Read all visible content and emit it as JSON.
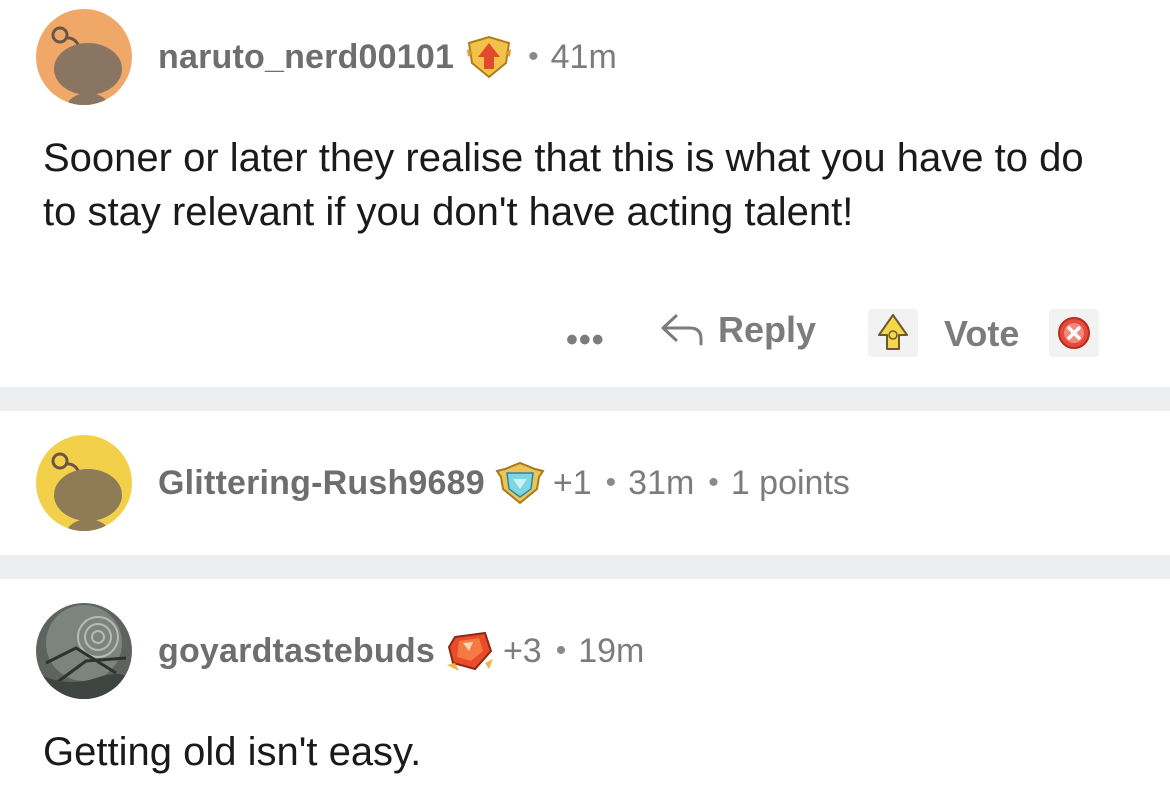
{
  "comments": [
    {
      "username": "naruto_nerd00101",
      "flair_icon": "orange-arrow-shield-badge-icon",
      "time": "41m",
      "body": "Sooner or later they realise that this is what you have to do to stay relevant if you don't have acting talent!",
      "avatar_color": "#f0a868",
      "actions": {
        "more": "•••",
        "reply": "Reply",
        "vote": "Vote"
      }
    },
    {
      "username": "Glittering-Rush9689",
      "flair_icon": "diamond-shield-badge-icon",
      "score": "+1",
      "time": "31m",
      "points": "1 points",
      "avatar_color": "#f3d04a"
    },
    {
      "username": "goyardtastebuds",
      "flair_icon": "red-gem-badge-icon",
      "score": "+3",
      "time": "19m",
      "body": "Getting old isn't easy."
    }
  ],
  "separator": "•",
  "colors": {
    "divider": "#edeef0",
    "meta_text": "#7c7c7c",
    "body_text": "#1a1a1b"
  }
}
